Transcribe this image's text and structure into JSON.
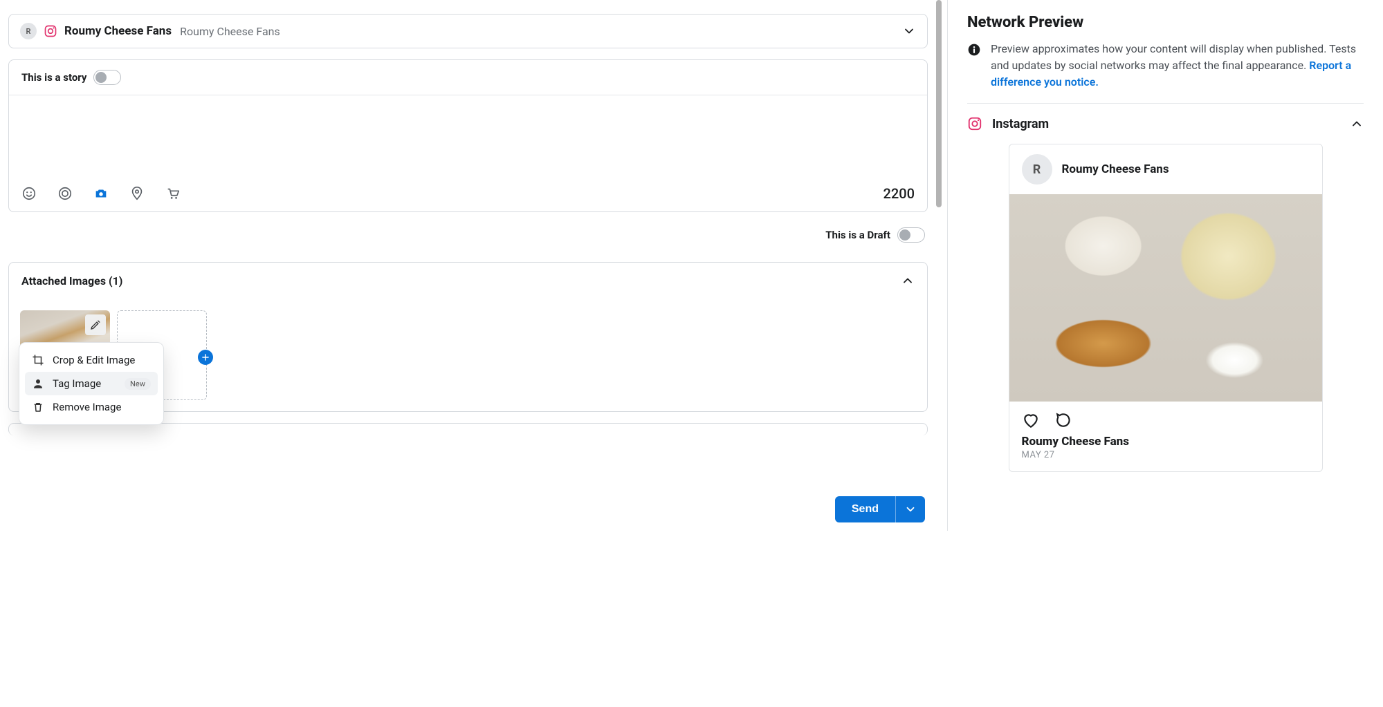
{
  "account": {
    "avatar_initial": "R",
    "name": "Roumy Cheese Fans",
    "subtitle": "Roumy Cheese Fans"
  },
  "composer": {
    "story_label": "This is a story",
    "story_on": false,
    "char_count": "2200",
    "draft_label": "This is a Draft",
    "draft_on": false
  },
  "attachments": {
    "title": "Attached Images (1)",
    "menu": {
      "crop": "Crop & Edit Image",
      "tag": "Tag Image",
      "tag_badge": "New",
      "remove": "Remove Image"
    }
  },
  "send": {
    "label": "Send"
  },
  "preview": {
    "heading": "Network Preview",
    "info_text": "Preview approximates how your content will display when published. Tests and updates by social networks may affect the final appearance. ",
    "info_link": "Report a difference you notice.",
    "network_name": "Instagram",
    "card": {
      "avatar_initial": "R",
      "name": "Roumy Cheese Fans",
      "username": "Roumy Cheese Fans",
      "date": "MAY 27"
    }
  }
}
